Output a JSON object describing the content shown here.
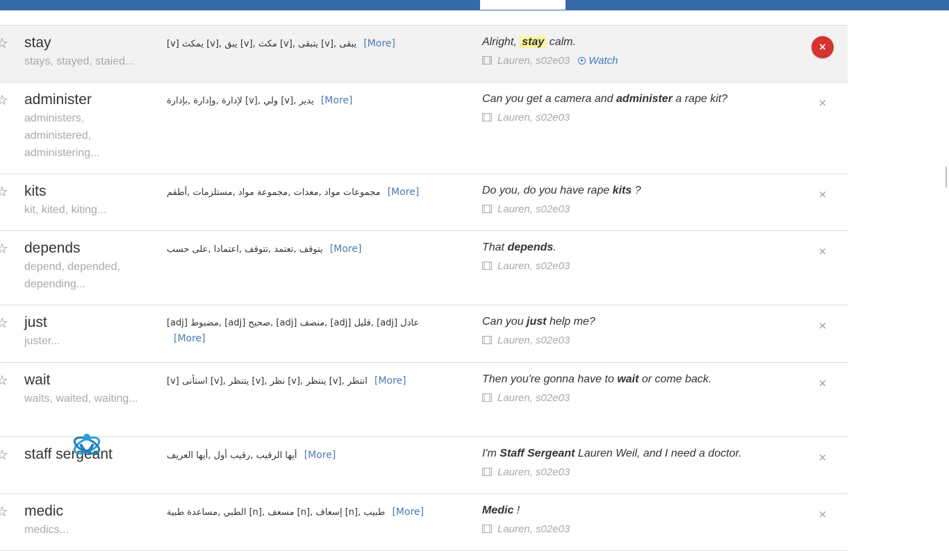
{
  "colors": {
    "topbar": "#3569a8",
    "link": "#4a79b5",
    "highlight": "#fdf59c",
    "remove_active": "#d63232"
  },
  "words": [
    {
      "word": "stay",
      "forms": "stays, stayed, staied...",
      "translation": "يبقى ,[v] يتبقى ,[v] مكث ,[v] يبق ,[v] يمكث [v]",
      "more": "[More]",
      "sentence": {
        "before": "Alright, ",
        "key": "stay",
        "after": " calm."
      },
      "source": "Lauren, s02e03",
      "watch": "Watch",
      "remove": "×"
    },
    {
      "word": "administer",
      "forms": "administers, administered, administering...",
      "translation": "يدير ,[v] ولي ,[v] لإدارة ,وإدارة ,بإدارة",
      "more": "[More]",
      "sentence": {
        "before": "Can you get a camera and ",
        "key": "administer",
        "after": " a rape kit?"
      },
      "source": "Lauren, s02e03",
      "remove": "×"
    },
    {
      "word": "kits",
      "forms": "kit, kited, kiting...",
      "translation": "مجموعات مواد ,معدات ,مجموعة مواد ,مستلزمات ,أطقم",
      "more": "[More]",
      "sentence": {
        "before": "Do you, do you have rape ",
        "key": "kits",
        "after": " ?"
      },
      "source": "Lauren, s02e03",
      "remove": "×"
    },
    {
      "word": "depends",
      "forms": "depend, depended, depending...",
      "translation": "يتوقف ,تعتمد ,تتوقف ,اعتمادا ,على حسب",
      "more": "[More]",
      "sentence": {
        "before": "That ",
        "key": "depends",
        "after": "."
      },
      "source": "Lauren, s02e03",
      "remove": "×"
    },
    {
      "word": "just",
      "forms": "juster...",
      "translation": "عادل [adj] ,قليل [adj] ,منصف [adj] ,صحيح [adj] ,مضبوط [adj]",
      "more": "[More]",
      "sentence": {
        "before": "Can you ",
        "key": "just",
        "after": " help me?"
      },
      "source": "Lauren, s02e03",
      "remove": "×"
    },
    {
      "word": "wait",
      "forms": "waits, waited, waiting...",
      "translation": "انتظر ,[v] ينتظر ,[v] نظر ,[v] يتنظر ,[v] استأنى [v]",
      "more": "[More]",
      "sentence": {
        "before": "Then you're gonna have to ",
        "key": "wait",
        "after": " or come back."
      },
      "source": "Lauren, s02e03",
      "remove": "×"
    },
    {
      "word": "staff sergeant",
      "forms": "",
      "translation": "أيها الرقيب ,رقيب أول ,أيها العريف",
      "more": "[More]",
      "sentence": {
        "before": "I'm ",
        "key": "Staff Sergeant",
        "after": " Lauren Weil, and I need a doctor."
      },
      "source": "Lauren, s02e03",
      "remove": "×"
    },
    {
      "word": "medic",
      "forms": "medics...",
      "translation": "طبيب ,[n] إسعاف ,[n] مسعف ,[n] الطبي ,مساعدة طبية",
      "more": "[More]",
      "sentence": {
        "before": "",
        "key": "Medic",
        "after": " !"
      },
      "source": "Lauren, s02e03",
      "remove": "×"
    }
  ]
}
